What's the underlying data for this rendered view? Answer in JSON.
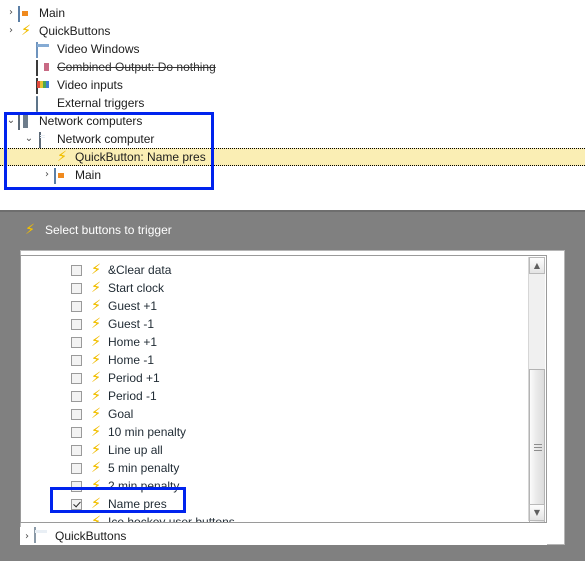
{
  "tree": {
    "items": [
      {
        "chevron": "›",
        "icon": "main-window-icon",
        "label": "Main",
        "style": "normal"
      },
      {
        "chevron": "›",
        "icon": "lightning-icon",
        "label": "QuickButtons",
        "style": "normal"
      },
      {
        "chevron": "",
        "icon": "video-window-icon",
        "label": "Video Windows",
        "style": "normal"
      },
      {
        "chevron": "",
        "icon": "combined-output-icon",
        "label": "Combined Output: Do nothing",
        "style": "strikethrough"
      },
      {
        "chevron": "",
        "icon": "video-inputs-icon",
        "label": "Video inputs",
        "style": "normal"
      },
      {
        "chevron": "",
        "icon": "external-triggers-icon",
        "label": "External triggers",
        "style": "normal"
      },
      {
        "chevron": "⌄",
        "icon": "network-computers-icon",
        "label": "Network computers",
        "style": "normal"
      },
      {
        "chevron": "⌄",
        "icon": "network-computer-icon",
        "label": "Network computer",
        "style": "normal"
      },
      {
        "chevron": "",
        "icon": "lightning-icon",
        "label": "QuickButton: Name pres",
        "style": "selected"
      },
      {
        "chevron": "›",
        "icon": "main-window-icon",
        "label": "Main",
        "style": "normal"
      }
    ]
  },
  "section": {
    "icon": "lightning-icon",
    "title": "Select buttons to trigger"
  },
  "button_list": {
    "items": [
      {
        "label": "&Clear data",
        "checked": false,
        "has_checkbox": true
      },
      {
        "label": "Start clock",
        "checked": false,
        "has_checkbox": true
      },
      {
        "label": "Guest +1",
        "checked": false,
        "has_checkbox": true
      },
      {
        "label": "Guest -1",
        "checked": false,
        "has_checkbox": true
      },
      {
        "label": "Home +1",
        "checked": false,
        "has_checkbox": true
      },
      {
        "label": "Home -1",
        "checked": false,
        "has_checkbox": true
      },
      {
        "label": "Period +1",
        "checked": false,
        "has_checkbox": true
      },
      {
        "label": "Period -1",
        "checked": false,
        "has_checkbox": true
      },
      {
        "label": "Goal",
        "checked": false,
        "has_checkbox": true
      },
      {
        "label": "10 min penalty",
        "checked": false,
        "has_checkbox": true
      },
      {
        "label": "Line up all",
        "checked": false,
        "has_checkbox": true
      },
      {
        "label": "5 min penalty",
        "checked": false,
        "has_checkbox": true
      },
      {
        "label": "2 min penalty",
        "checked": false,
        "has_checkbox": true
      },
      {
        "label": "Name pres",
        "checked": true,
        "has_checkbox": true
      },
      {
        "label": "Ice hockey user buttons",
        "checked": false,
        "has_checkbox": false
      }
    ]
  },
  "bottom_node": {
    "chevron": "›",
    "icon": "quickbuttons-window-icon",
    "label": "QuickButtons"
  },
  "scrollbar": {
    "up_arrow": "▲",
    "down_arrow": "▼"
  },
  "annotations": {
    "highlight_color": "#0023ee",
    "boxes": [
      {
        "name": "network-computers-highlight"
      },
      {
        "name": "name-pres-checkbox-highlight"
      }
    ]
  }
}
